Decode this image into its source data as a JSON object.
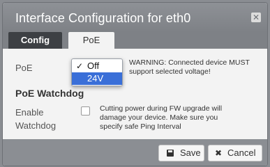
{
  "dialog": {
    "title": "Interface Configuration for eth0",
    "close_icon": "close-icon"
  },
  "tabs": [
    {
      "label": "Config",
      "active": false
    },
    {
      "label": "PoE",
      "active": true
    }
  ],
  "poe": {
    "label": "PoE",
    "options": [
      {
        "label": "Off",
        "checked": true
      },
      {
        "label": "24V",
        "highlighted": true
      }
    ],
    "check_mark": "✓",
    "warning": "WARNING: Connected device MUST support selected voltage!"
  },
  "watchdog": {
    "section_title": "PoE Watchdog",
    "enable_label_line1": "Enable",
    "enable_label_line2": "Watchdog",
    "checked": false,
    "note": "Cutting power during FW upgrade will damage your device. Make sure you specify safe Ping Interval"
  },
  "footer": {
    "save_label": "Save",
    "cancel_label": "Cancel",
    "save_icon": "save-icon",
    "cancel_icon": "cancel-icon"
  },
  "colors": {
    "titlebar": "#7e8186",
    "active_tab": "#3d4044",
    "highlight": "#3a6fd8"
  }
}
